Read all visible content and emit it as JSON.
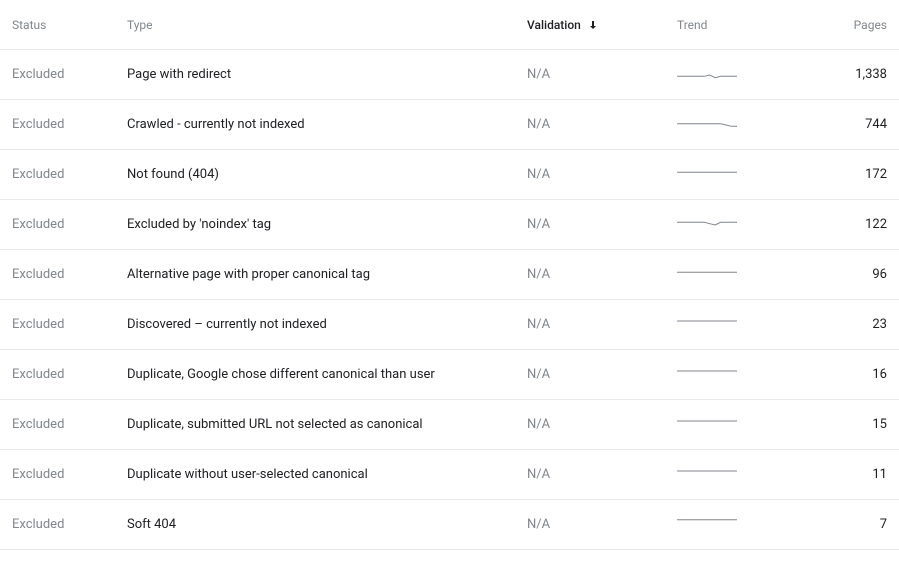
{
  "headers": {
    "status": "Status",
    "type": "Type",
    "validation": "Validation",
    "trend": "Trend",
    "pages": "Pages"
  },
  "sort": {
    "column": "validation",
    "direction": "desc"
  },
  "rows": [
    {
      "status": "Excluded",
      "type": "Page with redirect",
      "validation": "N/A",
      "pages": "1,338",
      "spark": [
        5,
        5,
        5,
        5,
        5,
        5,
        6,
        4,
        5,
        5,
        5,
        5
      ]
    },
    {
      "status": "Excluded",
      "type": "Crawled - currently not indexed",
      "validation": "N/A",
      "pages": "744",
      "spark": [
        7,
        7,
        7,
        7,
        7,
        7,
        7,
        7,
        7,
        6,
        5,
        5
      ]
    },
    {
      "status": "Excluded",
      "type": "Not found (404)",
      "validation": "N/A",
      "pages": "172",
      "spark": [
        8,
        8,
        8,
        8,
        8,
        8,
        8,
        8,
        8,
        8,
        8,
        8
      ]
    },
    {
      "status": "Excluded",
      "type": "Excluded by 'noindex' tag",
      "validation": "N/A",
      "pages": "122",
      "spark": [
        8,
        8,
        8,
        8,
        8,
        8,
        7,
        6,
        8,
        8,
        8,
        8
      ]
    },
    {
      "status": "Excluded",
      "type": "Alternative page with proper canonical tag",
      "validation": "N/A",
      "pages": "96",
      "spark": [
        8,
        8,
        8,
        8,
        8,
        8,
        8,
        8,
        8,
        8,
        8,
        8
      ]
    },
    {
      "status": "Excluded",
      "type": "Discovered – currently not indexed",
      "validation": "N/A",
      "pages": "23",
      "spark": [
        9,
        9,
        9,
        9,
        9,
        9,
        9,
        9,
        9,
        9,
        9,
        9
      ]
    },
    {
      "status": "Excluded",
      "type": "Duplicate, Google chose different canonical than user",
      "validation": "N/A",
      "pages": "16",
      "spark": [
        9,
        9,
        9,
        9,
        9,
        9,
        9,
        9,
        9,
        9,
        9,
        9
      ]
    },
    {
      "status": "Excluded",
      "type": "Duplicate, submitted URL not selected as canonical",
      "validation": "N/A",
      "pages": "15",
      "spark": [
        9,
        9,
        9,
        9,
        9,
        9,
        9,
        9,
        9,
        9,
        9,
        9
      ]
    },
    {
      "status": "Excluded",
      "type": "Duplicate without user-selected canonical",
      "validation": "N/A",
      "pages": "11",
      "spark": [
        9,
        9,
        9,
        9,
        9,
        9,
        9,
        9,
        9,
        9,
        9,
        9
      ]
    },
    {
      "status": "Excluded",
      "type": "Soft 404",
      "validation": "N/A",
      "pages": "7",
      "spark": [
        10,
        10,
        10,
        10,
        10,
        10,
        10,
        10,
        10,
        10,
        10,
        10
      ]
    }
  ]
}
